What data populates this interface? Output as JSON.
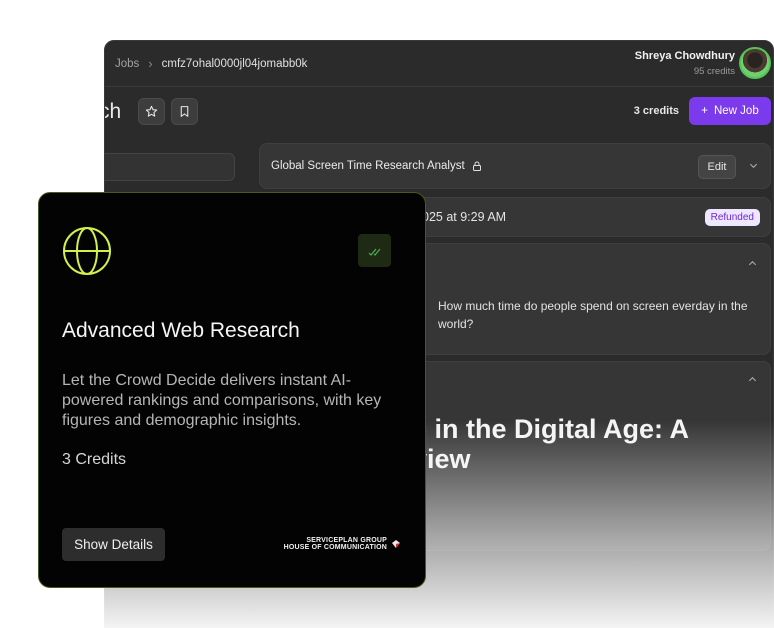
{
  "breadcrumb": {
    "section": "Jobs",
    "separator": "›",
    "job_id": "cmfz7ohal0000jl04jomabb0k"
  },
  "user": {
    "name": "Shreya Chowdhury",
    "credits": "95 credits"
  },
  "page": {
    "title": "ch"
  },
  "toolbar": {
    "credits": "3 credits",
    "new_job_label": "New Job",
    "new_job_icon": "+"
  },
  "job": {
    "title": "Global Screen Time Research Analyst",
    "edit_label": "Edit",
    "date": "025 at 9:29 AM",
    "status": "Refunded",
    "question": "How much time do people spend on screen everday in the world?",
    "report_title": "e in the Digital Age: A view"
  },
  "card": {
    "title": "Advanced Web Research",
    "description": "Let the Crowd Decide delivers instant AI-powered rankings and comparisons, with key figures and demographic insights.",
    "credits": "3 Credits",
    "button_label": "Show Details",
    "brand_line1": "SERVICEPLAN GROUP",
    "brand_line2": "HOUSE OF COMMUNICATION"
  },
  "colors": {
    "accent": "#7c3aed",
    "card_border": "#4a5a1e",
    "globe": "#d4f04a",
    "check": "#4caf50",
    "badge_bg": "#efe6ff"
  },
  "icons": [
    "star-icon",
    "bookmark-icon",
    "lock-icon",
    "chevron-down-icon",
    "chevron-up-icon",
    "globe-icon",
    "double-check-icon",
    "plus-icon"
  ]
}
